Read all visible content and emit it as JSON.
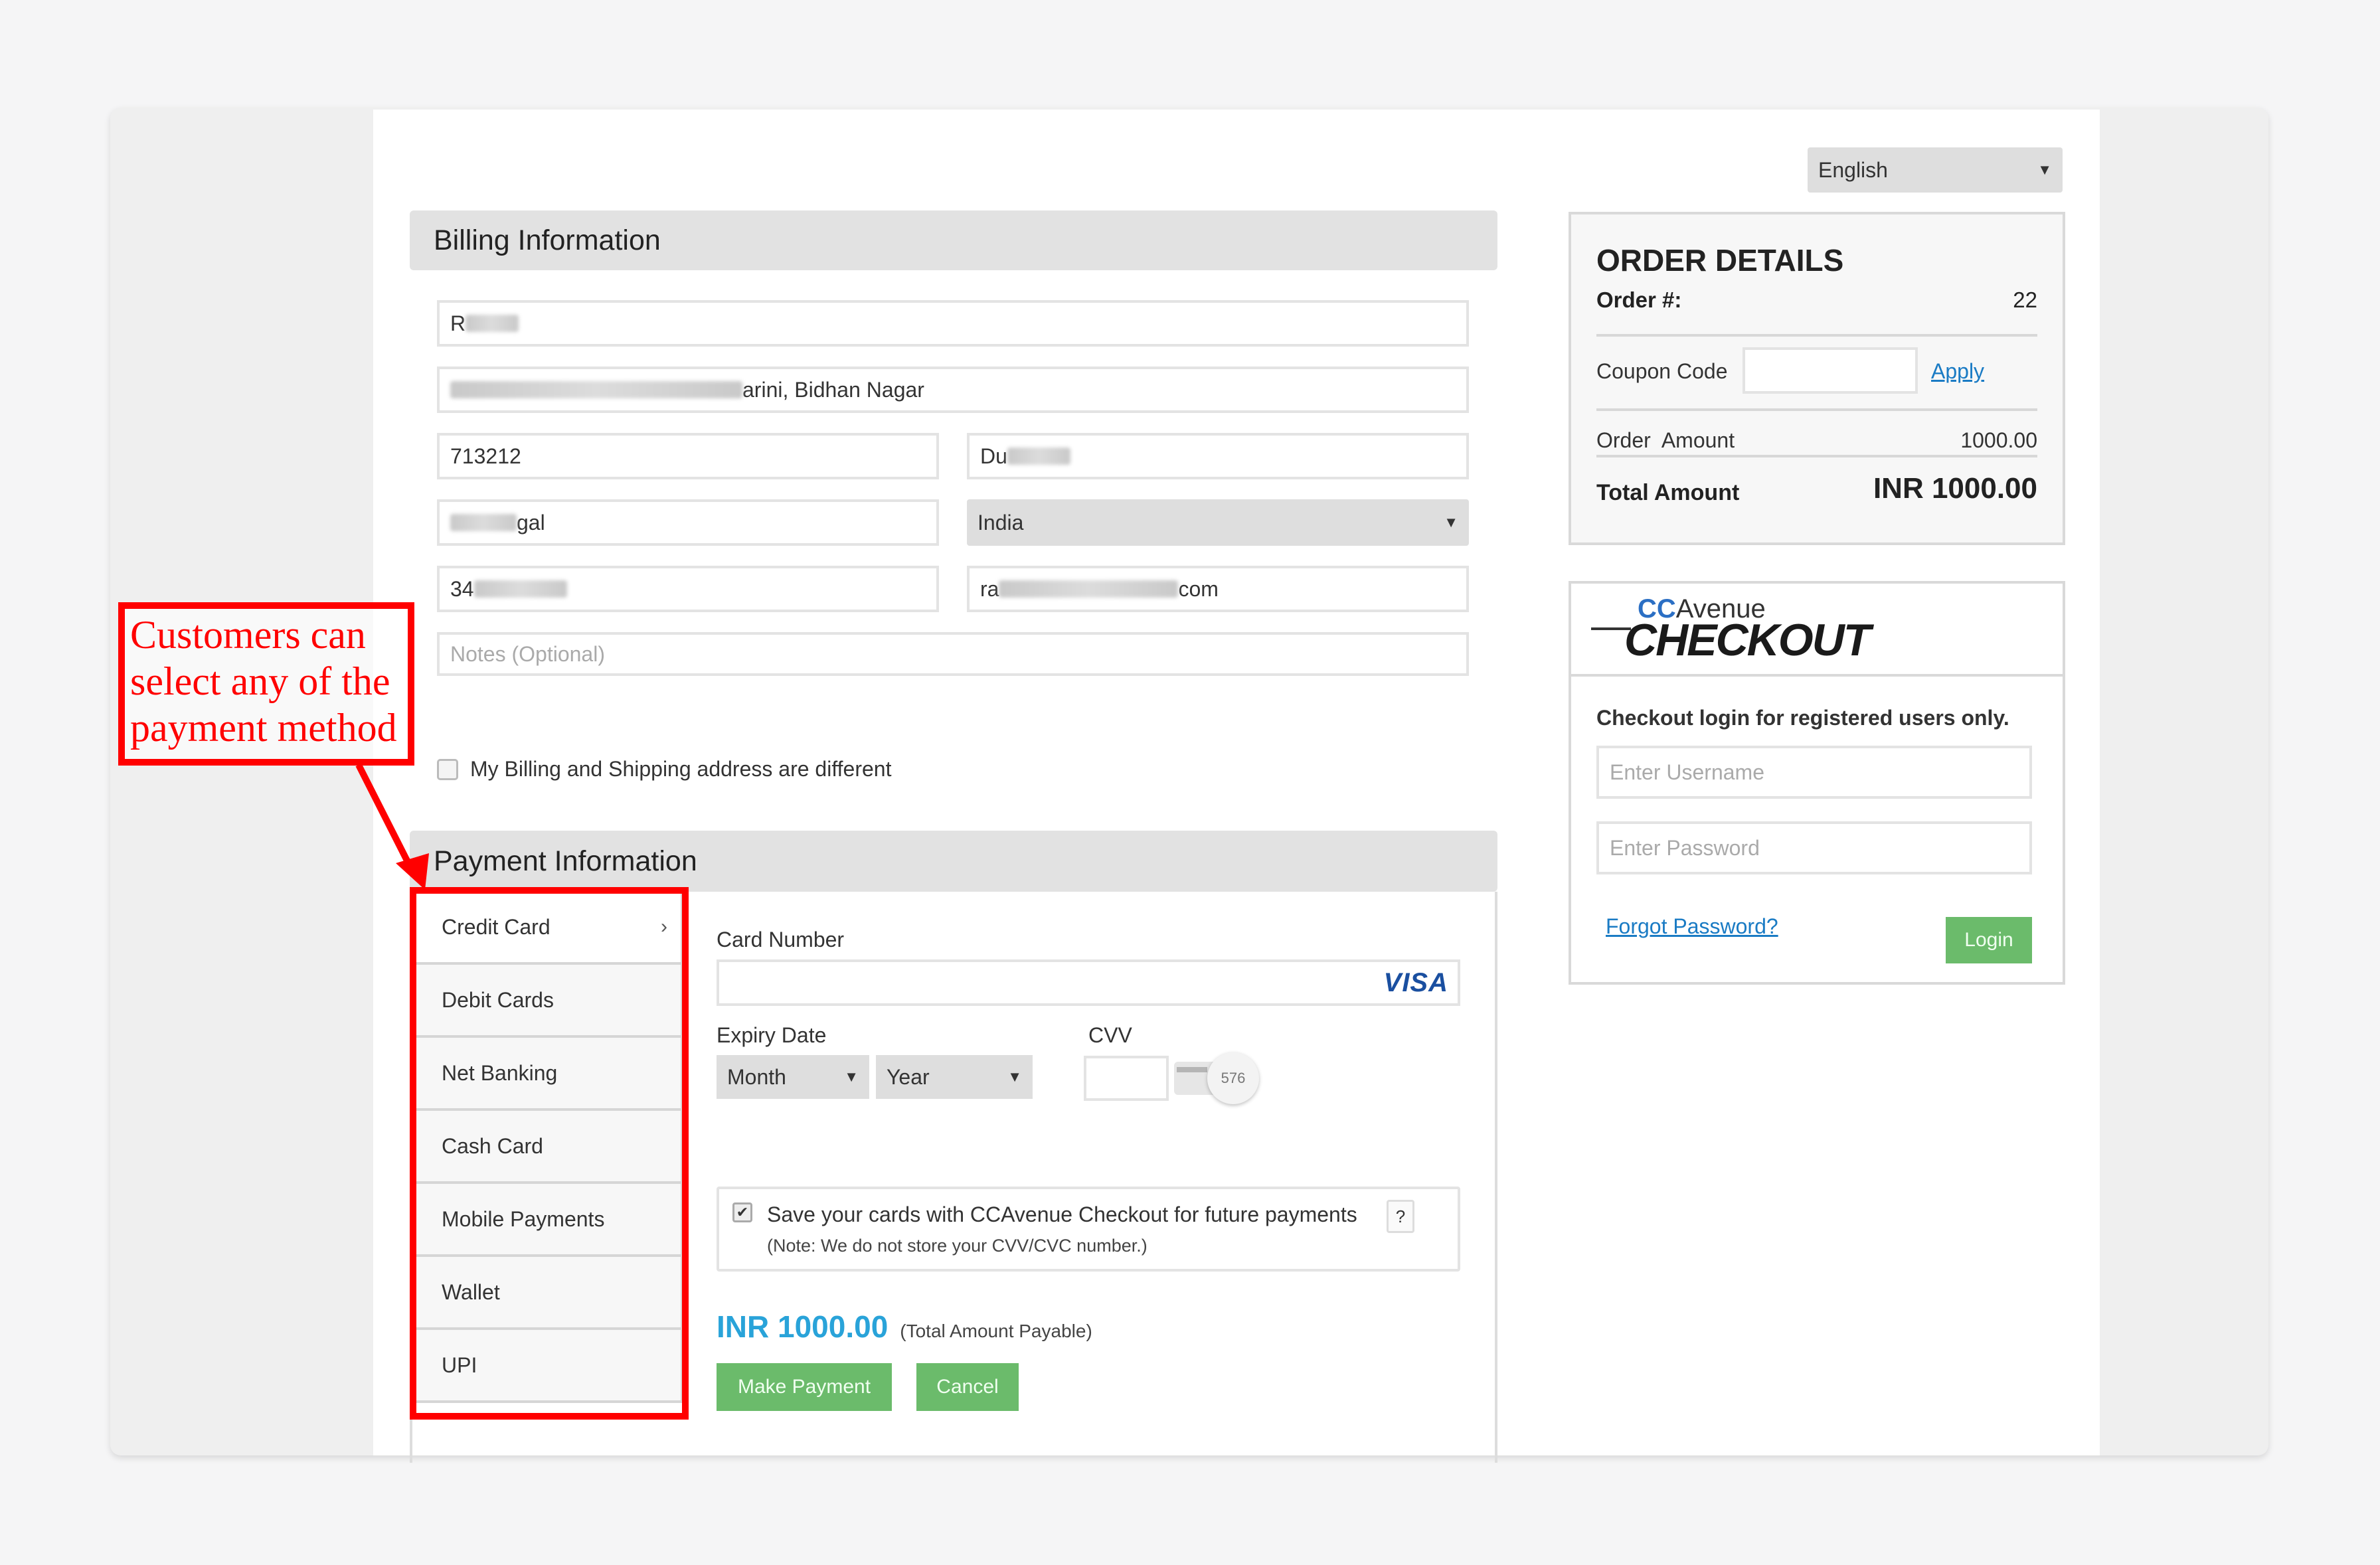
{
  "language": {
    "selected": "English"
  },
  "billing": {
    "title": "Billing Information",
    "name_visible": "R",
    "address_visible": "arini, Bidhan Nagar",
    "pincode": "713212",
    "city_visible": "Du",
    "state_visible": "gal",
    "country": "India",
    "phone_visible": "34",
    "email_prefix": "ra",
    "email_suffix": "com",
    "notes_placeholder": "Notes (Optional)",
    "different_address_label": "My Billing and Shipping address are different"
  },
  "payment": {
    "title": "Payment Information",
    "methods": [
      {
        "label": "Credit Card",
        "active": true
      },
      {
        "label": "Debit Cards"
      },
      {
        "label": "Net Banking"
      },
      {
        "label": "Cash Card"
      },
      {
        "label": "Mobile Payments"
      },
      {
        "label": "Wallet"
      },
      {
        "label": "UPI"
      }
    ],
    "card_number_label": "Card Number",
    "card_brand": "VISA",
    "expiry_label": "Expiry Date",
    "month_placeholder": "Month",
    "year_placeholder": "Year",
    "cvv_label": "CVV",
    "cvv_hint": "576",
    "save_card_label": "Save your cards with CCAvenue Checkout for future payments",
    "save_card_help": "?",
    "save_card_note": "(Note: We do not store your CVV/CVC number.)",
    "save_card_checked": true,
    "amount": "INR 1000.00",
    "amount_note": "(Total Amount Payable)",
    "make_payment": "Make Payment",
    "cancel": "Cancel"
  },
  "order": {
    "title": "ORDER DETAILS",
    "order_no_label": "Order #:",
    "order_no": "22",
    "coupon_label": "Coupon Code",
    "apply": "Apply",
    "order_amount_label": "Order  Amount",
    "order_amount": "1000.00",
    "total_label": "Total Amount",
    "total": "INR 1000.00"
  },
  "checkout": {
    "logo_cc": "CC",
    "logo_avenue": "Avenue",
    "logo_checkout": "CHECKOUT",
    "login_note": "Checkout login for registered users only.",
    "username_placeholder": "Enter Username",
    "password_placeholder": "Enter Password",
    "forgot": "Forgot Password?",
    "login": "Login"
  },
  "annotation": {
    "text": "Customers can select any of the payment method",
    "color": "#ff0000"
  }
}
